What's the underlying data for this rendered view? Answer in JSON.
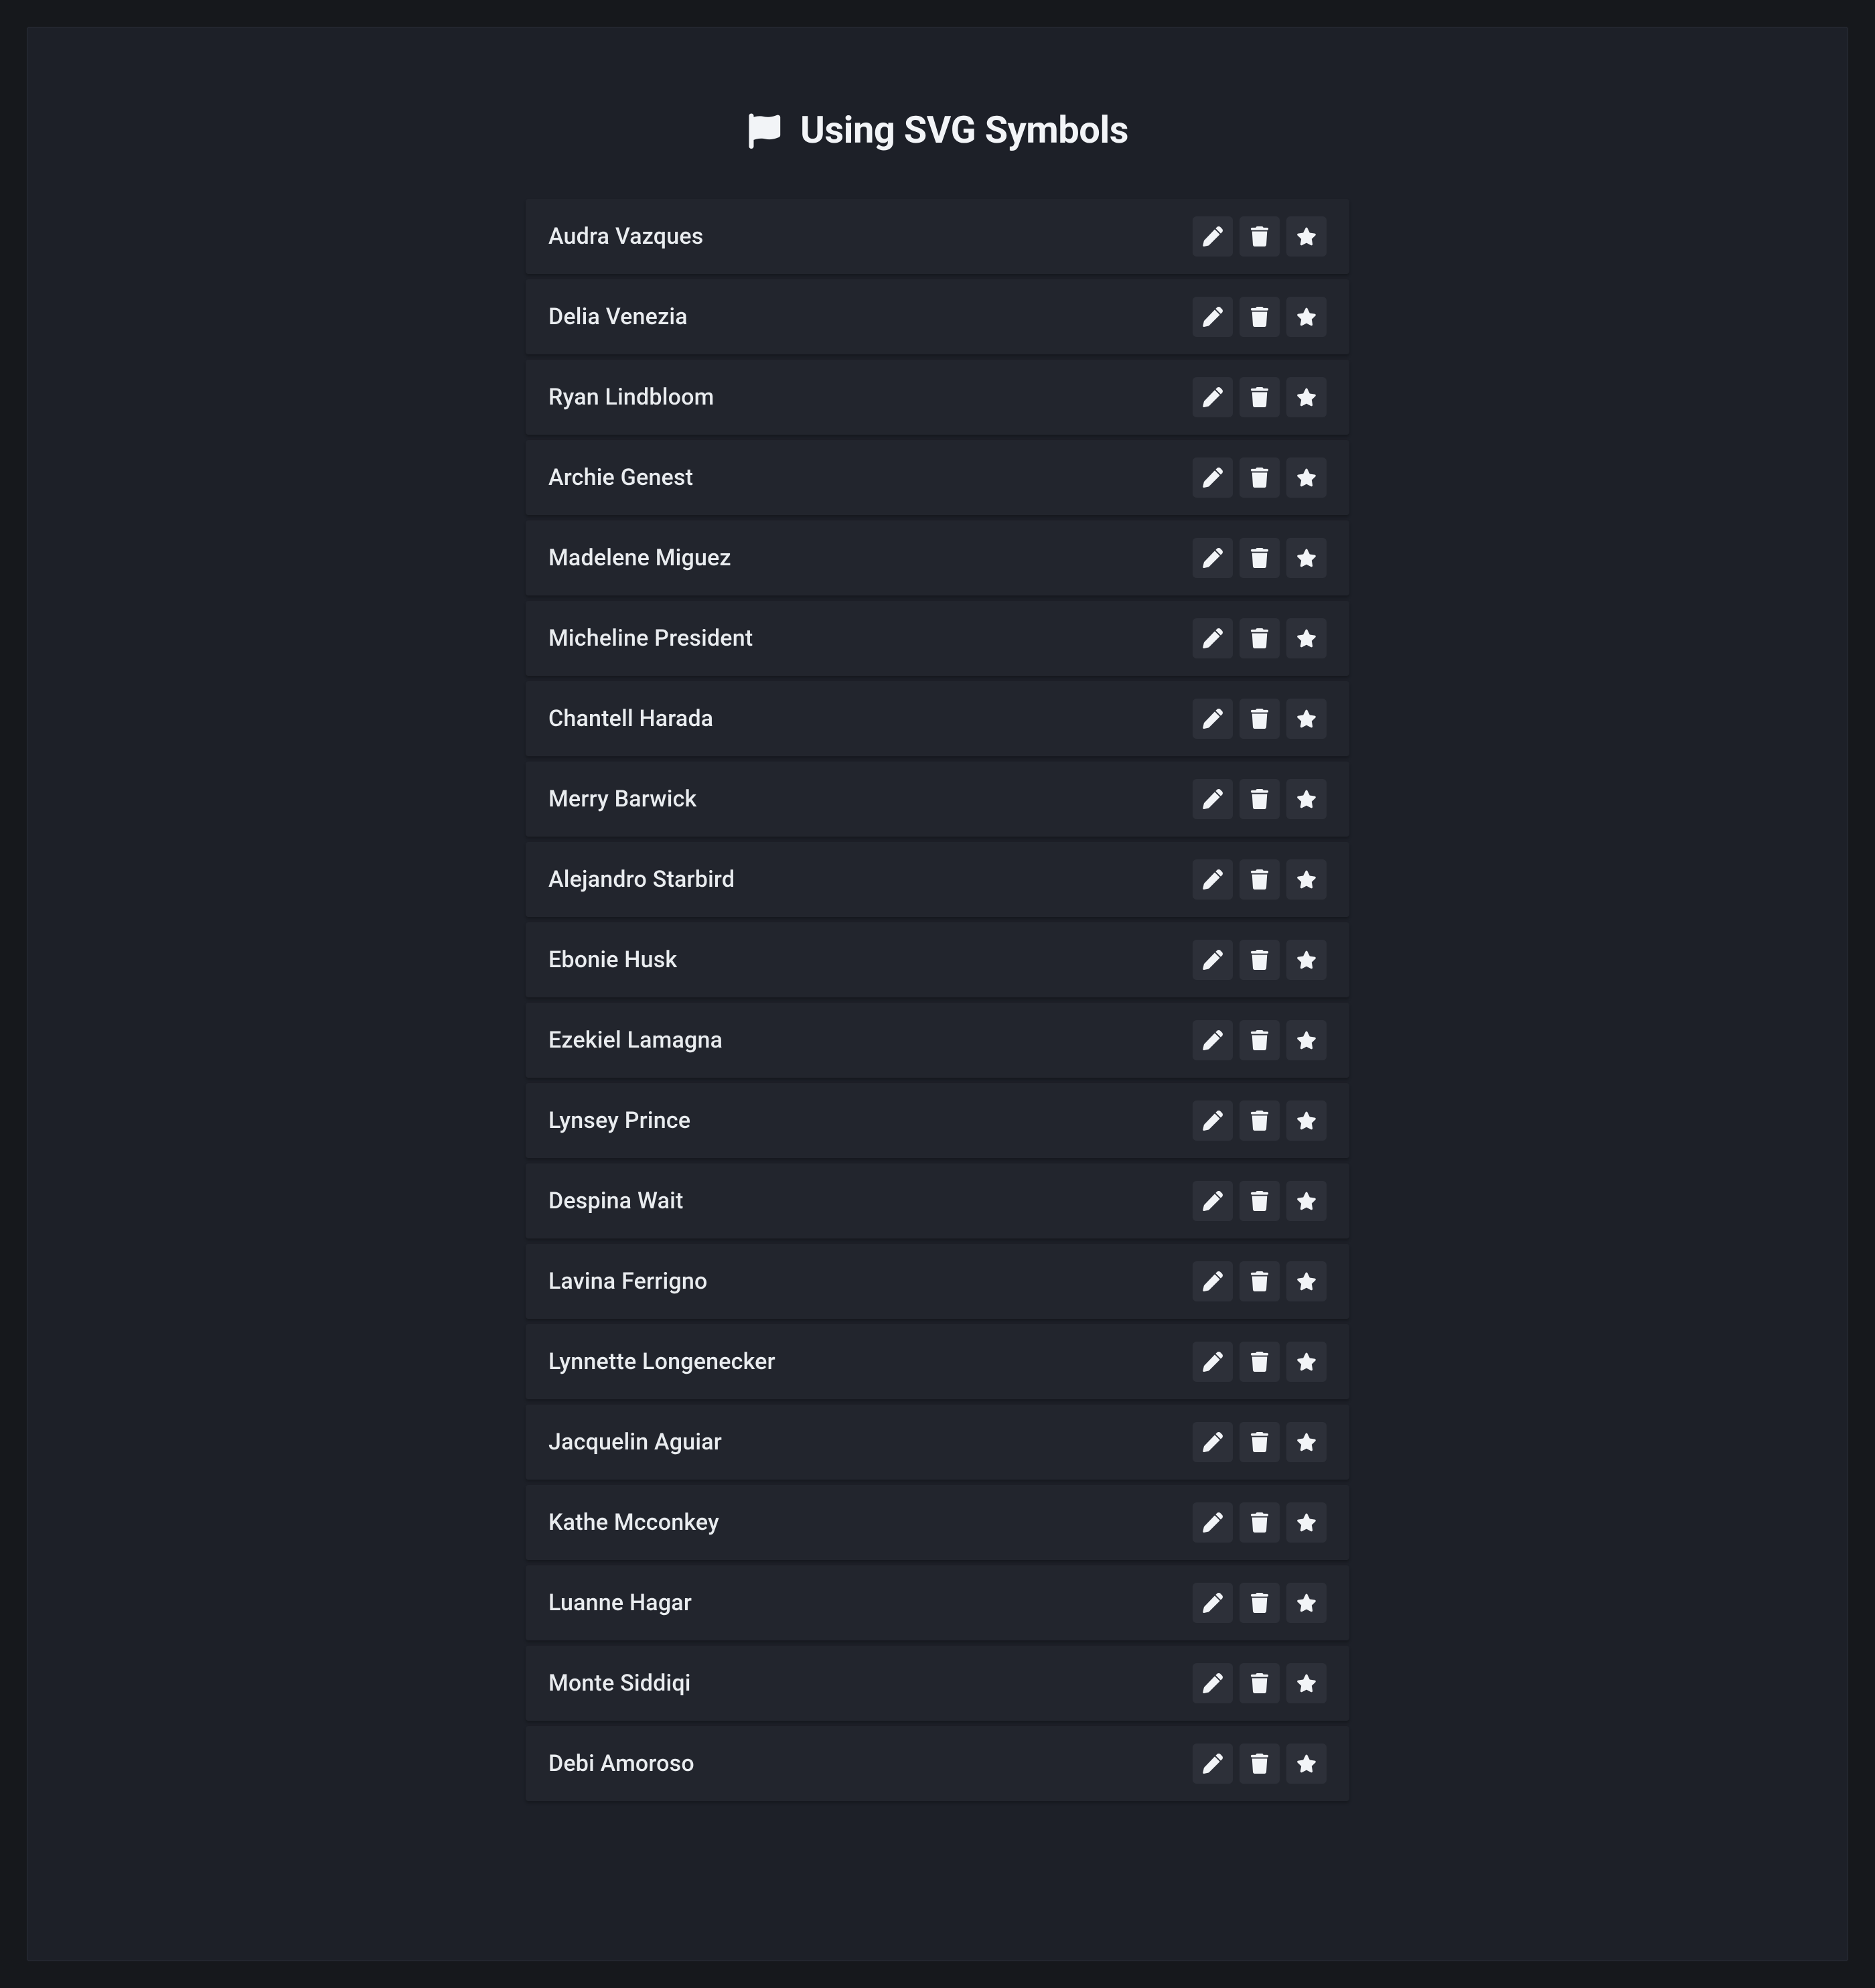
{
  "header": {
    "title": "Using SVG Symbols",
    "icon": "flag-icon"
  },
  "actions": {
    "edit_icon": "pencil-icon",
    "delete_icon": "trash-icon",
    "star_icon": "star-icon"
  },
  "list": {
    "items": [
      {
        "name": "Audra Vazques"
      },
      {
        "name": "Delia Venezia"
      },
      {
        "name": "Ryan Lindbloom"
      },
      {
        "name": "Archie Genest"
      },
      {
        "name": "Madelene Miguez"
      },
      {
        "name": "Micheline President"
      },
      {
        "name": "Chantell Harada"
      },
      {
        "name": "Merry Barwick"
      },
      {
        "name": "Alejandro Starbird"
      },
      {
        "name": "Ebonie Husk"
      },
      {
        "name": "Ezekiel Lamagna"
      },
      {
        "name": "Lynsey Prince"
      },
      {
        "name": "Despina Wait"
      },
      {
        "name": "Lavina Ferrigno"
      },
      {
        "name": "Lynnette Longenecker"
      },
      {
        "name": "Jacquelin Aguiar"
      },
      {
        "name": "Kathe Mcconkey"
      },
      {
        "name": "Luanne Hagar"
      },
      {
        "name": "Monte Siddiqi"
      },
      {
        "name": "Debi Amoroso"
      }
    ]
  }
}
